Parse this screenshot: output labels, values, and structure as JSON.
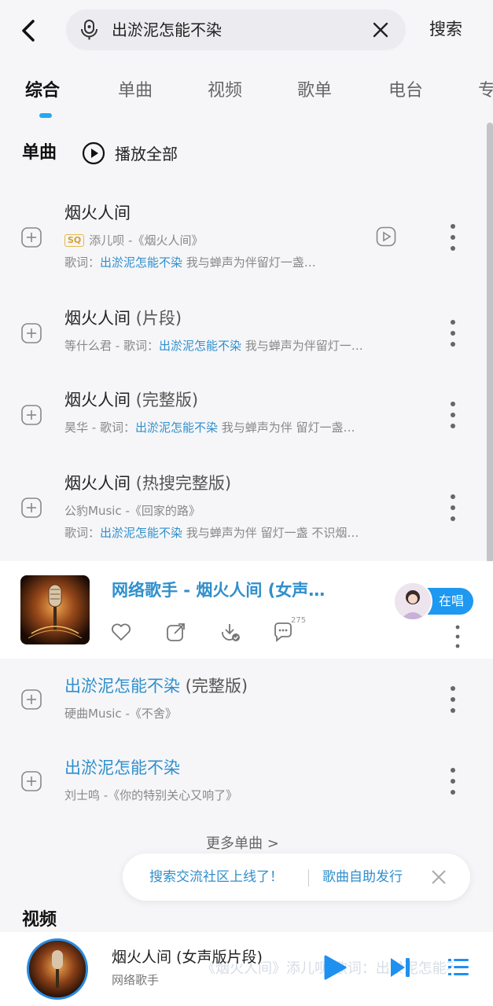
{
  "header": {
    "query": "出淤泥怎能不染",
    "search_label": "搜索"
  },
  "tabs": [
    {
      "label": "综合",
      "active": true
    },
    {
      "label": "单曲",
      "active": false
    },
    {
      "label": "视频",
      "active": false
    },
    {
      "label": "歌单",
      "active": false
    },
    {
      "label": "电台",
      "active": false
    },
    {
      "label": "专",
      "active": false
    }
  ],
  "section": {
    "title": "单曲",
    "play_all": "播放全部"
  },
  "songs": [
    {
      "title": "烟火人间",
      "badge": "SQ",
      "artist_album": "添儿呗 -《烟火人间》",
      "lyric_prefix": "歌词：",
      "lyric_match": "出淤泥怎能不染",
      "lyric_rest": " 我与蝉声为伴留灯一盏…"
    },
    {
      "title": "烟火人间",
      "suffix": " (片段)",
      "meta_prefix": "等什么君 - 歌词：",
      "lyric_match": "出淤泥怎能不染",
      "lyric_rest": " 我与蝉声为伴留灯一…"
    },
    {
      "title": "烟火人间",
      "suffix": " (完整版)",
      "meta_prefix": "昊华 - 歌词：",
      "lyric_match": "出淤泥怎能不染",
      "lyric_rest": " 我与蝉声为伴 留灯一盏…"
    },
    {
      "title": "烟火人间",
      "suffix": " (热搜完整版)",
      "artist_album": "公豹Music -《回家的路》",
      "lyric_prefix": "歌词：",
      "lyric_match": "出淤泥怎能不染",
      "lyric_rest": " 我与蝉声为伴 留灯一盏 不识烟…"
    }
  ],
  "highlight": {
    "title": "网络歌手 - 烟火人间 (女声…",
    "comment_count": "275",
    "singing_label": "在唱"
  },
  "songs2": [
    {
      "title": "出淤泥怎能不染",
      "suffix": " (完整版)",
      "artist_album": "硬曲Music -《不舍》"
    },
    {
      "title": "出淤泥怎能不染",
      "artist_album": "刘士鸣 -《你的特别关心又响了》"
    }
  ],
  "more_songs": "更多单曲 >",
  "toast": {
    "left": "搜索交流社区上线了！",
    "right": "歌曲自助发行"
  },
  "video_section": {
    "title": "视频"
  },
  "player": {
    "title": "烟火人间 (女声版片段)",
    "artist": "网络歌手",
    "background_text": "《烟火人间》添儿呗 歌词：出淤泥怎能不染"
  },
  "colors": {
    "accent": "#25a8f0",
    "highlight_text": "#2f8fcc"
  }
}
